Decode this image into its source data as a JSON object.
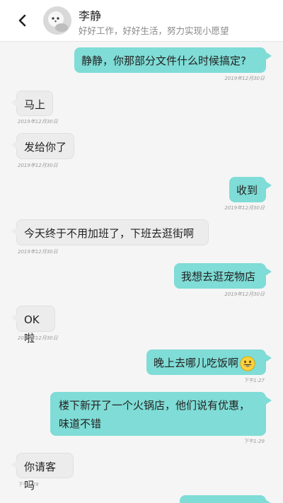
{
  "contact": {
    "name": "李静",
    "status": "好好工作，好好生活，努力实现小愿望"
  },
  "icons": {
    "back": "chevron-left-icon",
    "emoji": "grinning-face-icon"
  },
  "colors": {
    "outgoing_bubble": "#7fdcd6",
    "incoming_bubble": "#ececec"
  },
  "messages": [
    {
      "side": "right",
      "text": "静静，你那部分文件什么时候搞定?",
      "time": "2019年12月30日"
    },
    {
      "side": "left",
      "text": "马上",
      "time": "2019年12月30日"
    },
    {
      "side": "left",
      "text": "发给你了",
      "time": "2019年12月30日"
    },
    {
      "side": "right",
      "text": "收到",
      "time": "2019年12月30日"
    },
    {
      "side": "left",
      "text": "今天终于不用加班了，下班去逛街啊",
      "time": "2019年12月30日"
    },
    {
      "side": "right",
      "text": "我想去逛宠物店",
      "time": "2019年12月30日"
    },
    {
      "side": "left",
      "text": "OK啦",
      "time": "2019年12月30日"
    },
    {
      "side": "right",
      "text": "晚上去哪儿吃饭啊",
      "time": "下午1:27"
    },
    {
      "side": "right",
      "text": "楼下新开了一个火锅店，他们说有优惠，味道不错",
      "time": "下午1:29"
    },
    {
      "side": "left",
      "text": "你请客吗",
      "time": "下午1:29"
    }
  ]
}
